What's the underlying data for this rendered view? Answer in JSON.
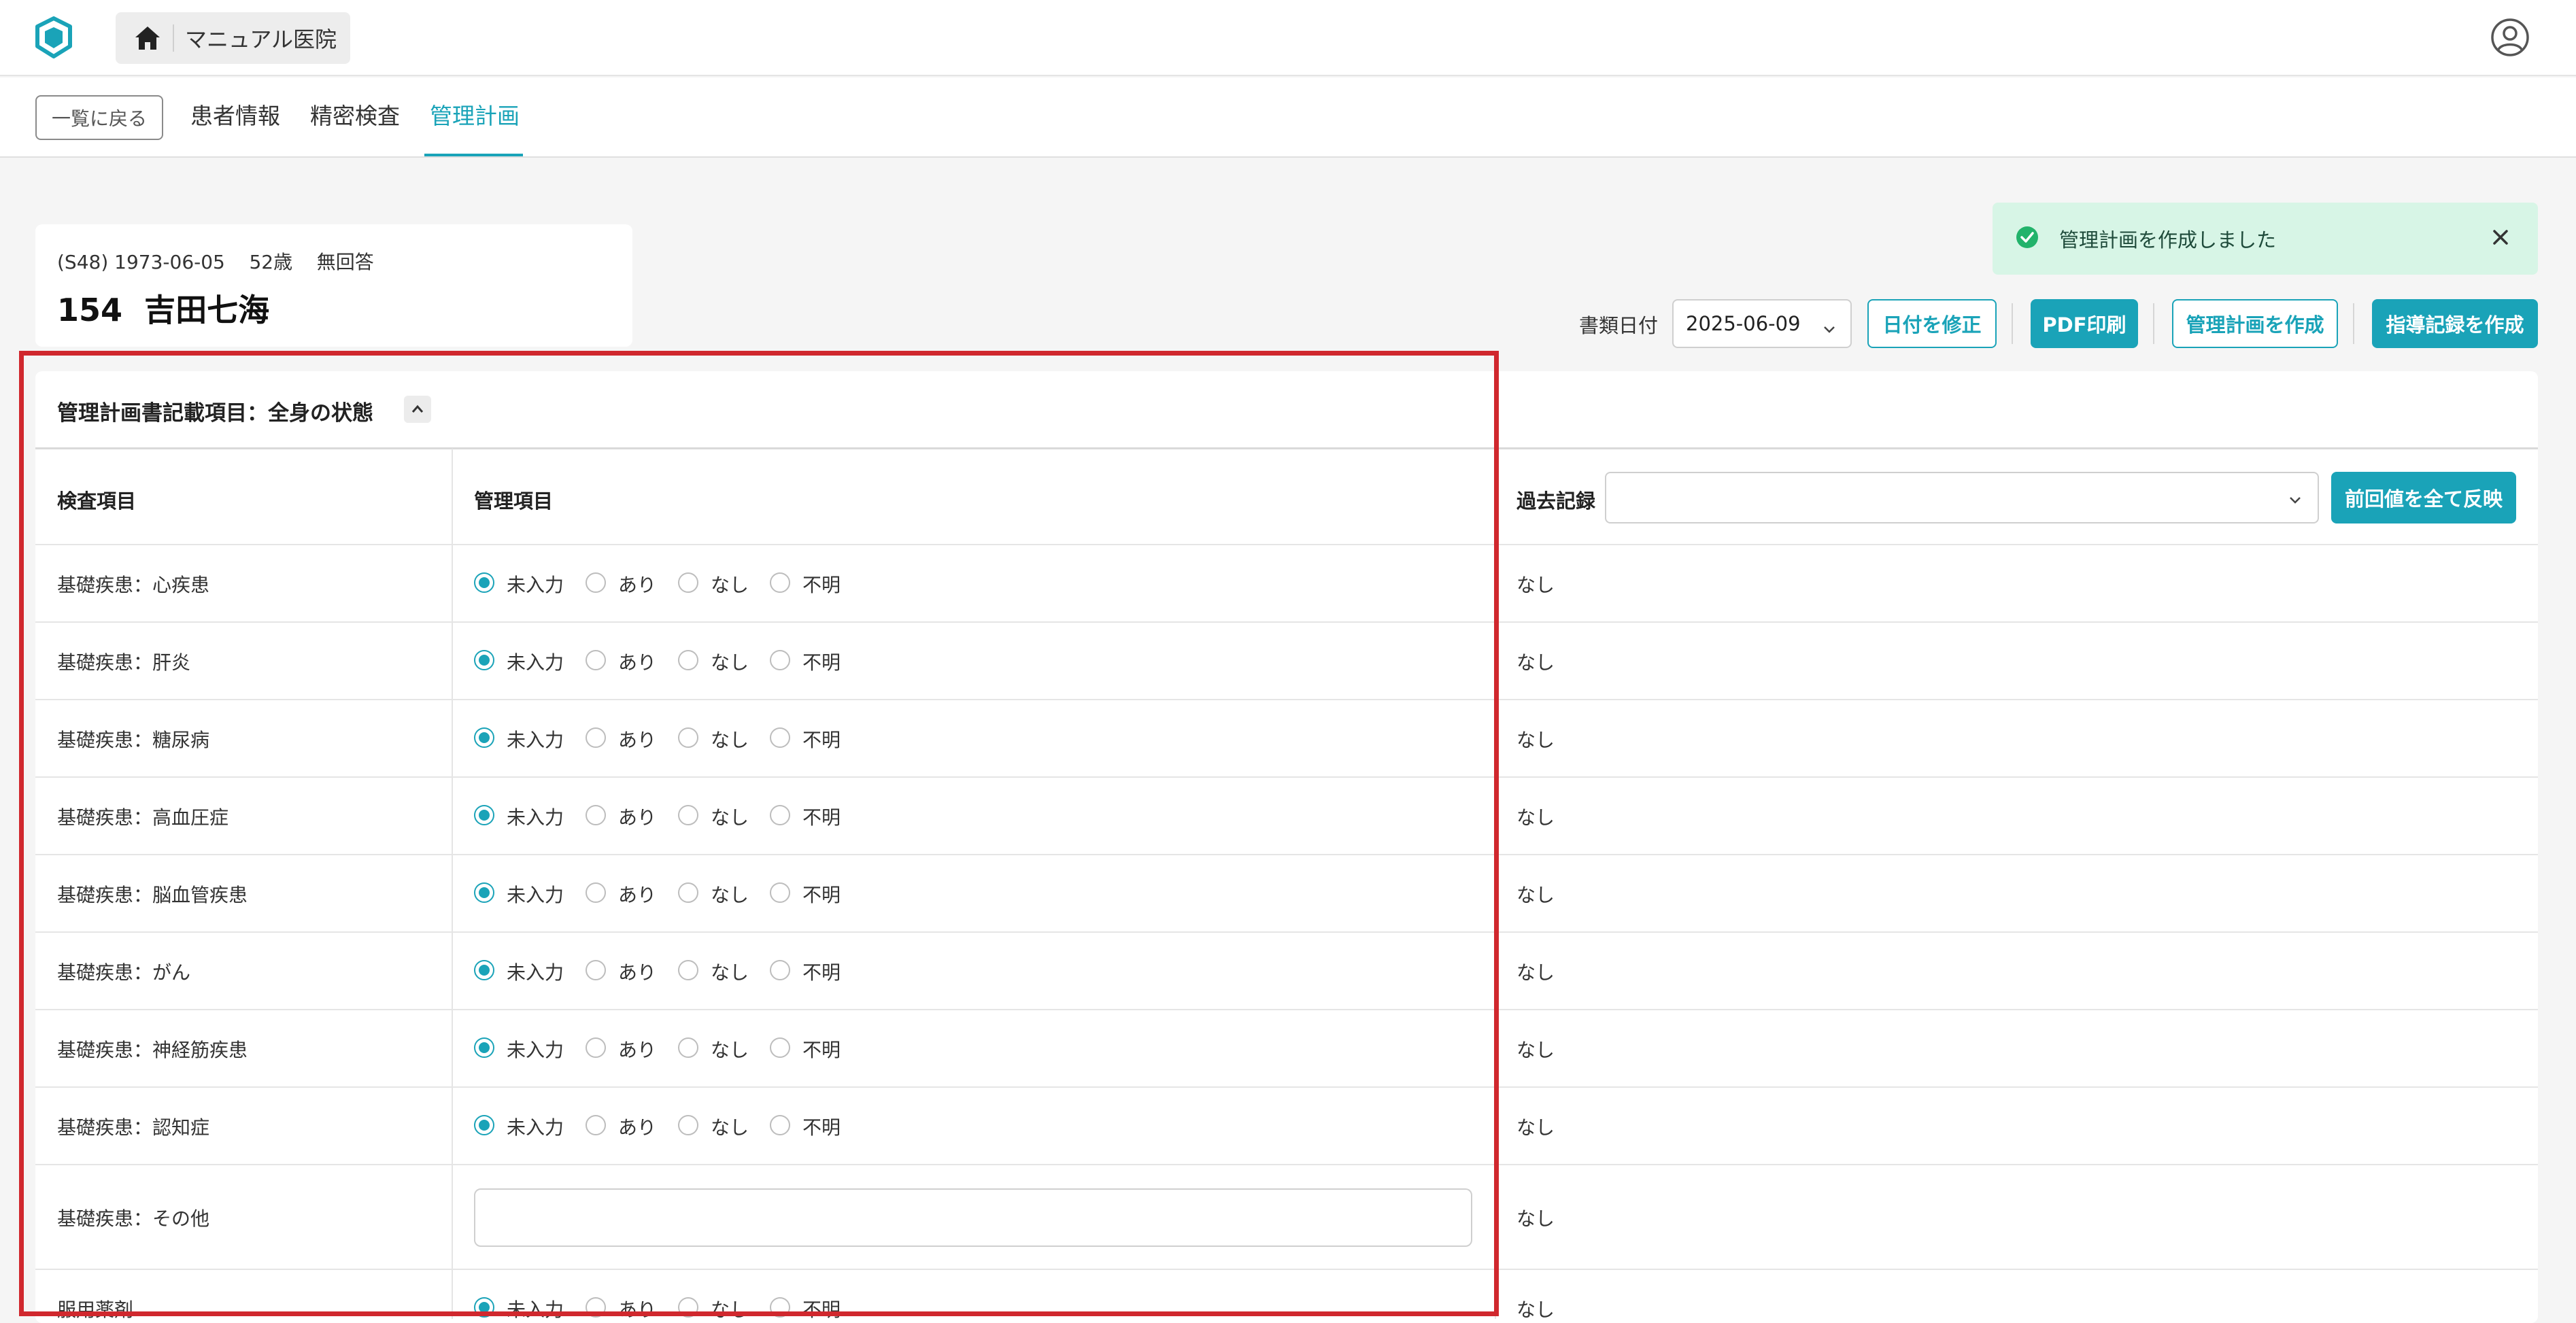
{
  "header": {
    "logo_icon": "shield-logo-icon",
    "home_icon": "home-icon",
    "clinic_name": "マニュアル医院",
    "user_icon": "user-circle-icon"
  },
  "subnav": {
    "back_label": "一覧に戻る",
    "tabs": [
      {
        "label": "患者情報",
        "active": false
      },
      {
        "label": "精密検査",
        "active": false
      },
      {
        "label": "管理計画",
        "active": true
      }
    ]
  },
  "patient": {
    "era_birth": "(S48) 1973-06-05",
    "age": "52歳",
    "gender": "無回答",
    "id": "154",
    "name": "吉田七海"
  },
  "toast": {
    "message": "管理計画を作成しました",
    "status_icon": "check-circle-icon",
    "close_icon": "close-icon"
  },
  "toolbar": {
    "date_label": "書類日付",
    "date_value": "2025-06-09",
    "fix_date_label": "日付を修正",
    "pdf_label": "PDF印刷",
    "create_plan_label": "管理計画を作成",
    "create_record_label": "指導記録を作成"
  },
  "section": {
    "title": "管理計画書記載項目：全身の状態",
    "collapse_icon": "chevron-up-icon"
  },
  "table": {
    "headers": {
      "item": "検査項目",
      "management": "管理項目",
      "past": "過去記録",
      "apply_all_label": "前回値を全て反映",
      "past_select_value": ""
    },
    "radio_options": [
      "未入力",
      "あり",
      "なし",
      "不明"
    ],
    "rows": [
      {
        "label": "基礎疾患：心疾患",
        "type": "radio",
        "selected": "未入力",
        "past": "なし"
      },
      {
        "label": "基礎疾患：肝炎",
        "type": "radio",
        "selected": "未入力",
        "past": "なし"
      },
      {
        "label": "基礎疾患：糖尿病",
        "type": "radio",
        "selected": "未入力",
        "past": "なし"
      },
      {
        "label": "基礎疾患：高血圧症",
        "type": "radio",
        "selected": "未入力",
        "past": "なし"
      },
      {
        "label": "基礎疾患：脳血管疾患",
        "type": "radio",
        "selected": "未入力",
        "past": "なし"
      },
      {
        "label": "基礎疾患：がん",
        "type": "radio",
        "selected": "未入力",
        "past": "なし"
      },
      {
        "label": "基礎疾患：神経筋疾患",
        "type": "radio",
        "selected": "未入力",
        "past": "なし"
      },
      {
        "label": "基礎疾患：認知症",
        "type": "radio",
        "selected": "未入力",
        "past": "なし"
      },
      {
        "label": "基礎疾患：その他",
        "type": "text",
        "value": "",
        "past": "なし"
      },
      {
        "label": "服用薬剤",
        "type": "radio",
        "selected": "未入力",
        "past": "なし"
      }
    ]
  },
  "colors": {
    "accent": "#1aa3b8",
    "toast_bg": "#d7f5e6",
    "highlight": "#d0282e"
  }
}
